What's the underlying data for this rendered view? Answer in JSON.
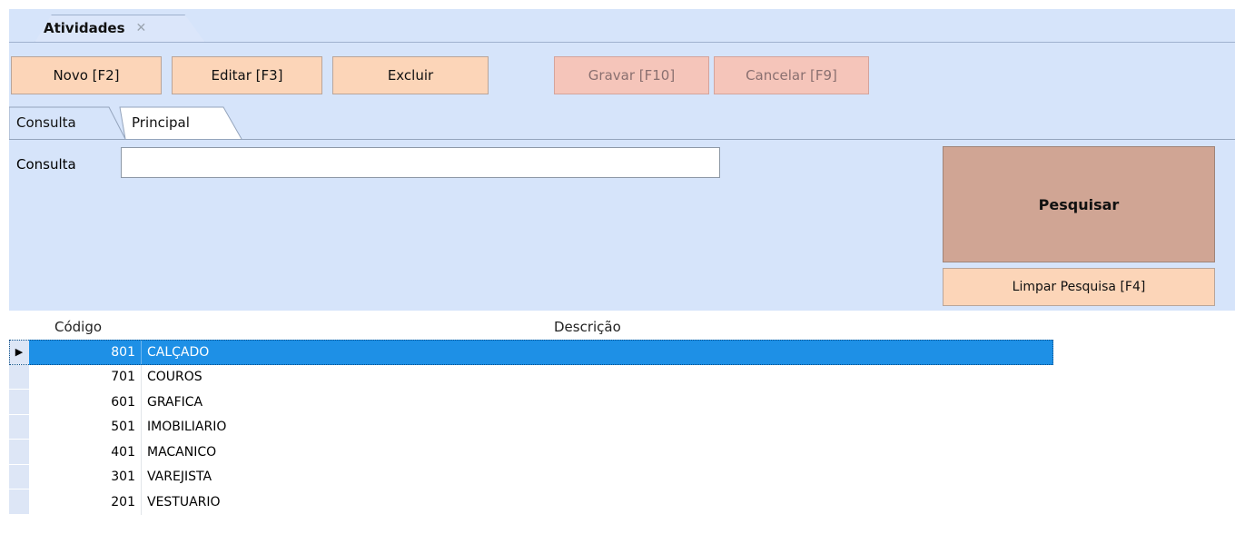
{
  "document_tab": {
    "label": "Atividades",
    "close_icon": "✕"
  },
  "toolbar": {
    "novo": "Novo [F2]",
    "editar": "Editar [F3]",
    "excluir": "Excluir",
    "gravar": "Gravar [F10]",
    "cancelar": "Cancelar [F9]"
  },
  "sub_tabs": {
    "consulta": "Consulta",
    "principal": "Principal"
  },
  "search": {
    "label": "Consulta",
    "value": "",
    "search_button": "Pesquisar",
    "clear_button": "Limpar Pesquisa [F4]"
  },
  "grid": {
    "columns": {
      "codigo": "Código",
      "descricao": "Descrição"
    },
    "rows": [
      {
        "codigo": "801",
        "descricao": "CALÇADO",
        "selected": true
      },
      {
        "codigo": "701",
        "descricao": "COUROS"
      },
      {
        "codigo": "601",
        "descricao": "GRAFICA"
      },
      {
        "codigo": "501",
        "descricao": "IMOBILIARIO"
      },
      {
        "codigo": "401",
        "descricao": "MACANICO"
      },
      {
        "codigo": "301",
        "descricao": "VAREJISTA"
      },
      {
        "codigo": "201",
        "descricao": "VESTUARIO"
      }
    ]
  },
  "colors": {
    "panel_bg": "#d6e4fa",
    "button_bg": "#fcd5b8",
    "button_disabled_bg": "#f5c5ba",
    "search_button_bg": "#d0a594",
    "selection": "#1e90e6"
  }
}
